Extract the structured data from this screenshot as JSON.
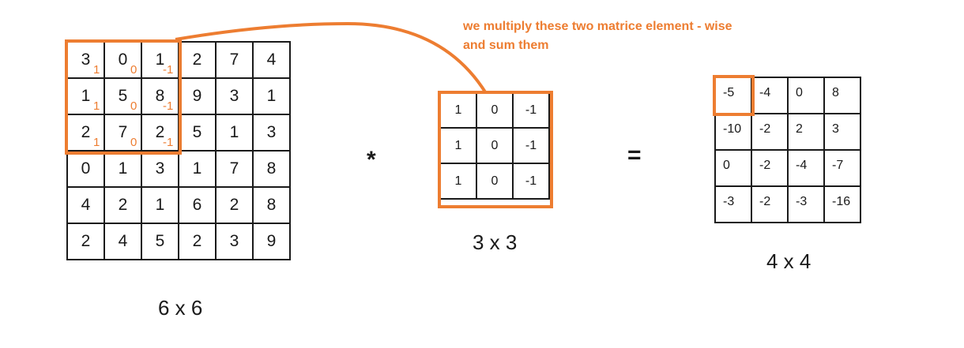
{
  "annotation": {
    "line1": "we multiply these two matrice element - wise",
    "line2": "and sum them"
  },
  "input": {
    "size_label": "6 x 6",
    "rows": [
      [
        "3",
        "0",
        "1",
        "2",
        "7",
        "4"
      ],
      [
        "1",
        "5",
        "8",
        "9",
        "3",
        "1"
      ],
      [
        "2",
        "7",
        "2",
        "5",
        "1",
        "3"
      ],
      [
        "0",
        "1",
        "3",
        "1",
        "7",
        "8"
      ],
      [
        "4",
        "2",
        "1",
        "6",
        "2",
        "8"
      ],
      [
        "2",
        "4",
        "5",
        "2",
        "3",
        "9"
      ]
    ],
    "overlay_weights": [
      [
        "1",
        "0",
        "-1"
      ],
      [
        "1",
        "0",
        "-1"
      ],
      [
        "1",
        "0",
        "-1"
      ]
    ]
  },
  "kernel": {
    "size_label": "3 x 3",
    "rows": [
      [
        "1",
        "0",
        "-1"
      ],
      [
        "1",
        "0",
        "-1"
      ],
      [
        "1",
        "0",
        "-1"
      ]
    ]
  },
  "output": {
    "size_label": "4 x 4",
    "rows": [
      [
        "-5",
        "-4",
        "0",
        "8"
      ],
      [
        "-10",
        "-2",
        "2",
        "3"
      ],
      [
        "0",
        "-2",
        "-4",
        "-7"
      ],
      [
        "-3",
        "-2",
        "-3",
        "-16"
      ]
    ]
  },
  "operators": {
    "convolve": "*",
    "equals": "="
  },
  "colors": {
    "accent": "#ed7d31",
    "grid": "#1a1a1a",
    "background": "#ffffff"
  }
}
